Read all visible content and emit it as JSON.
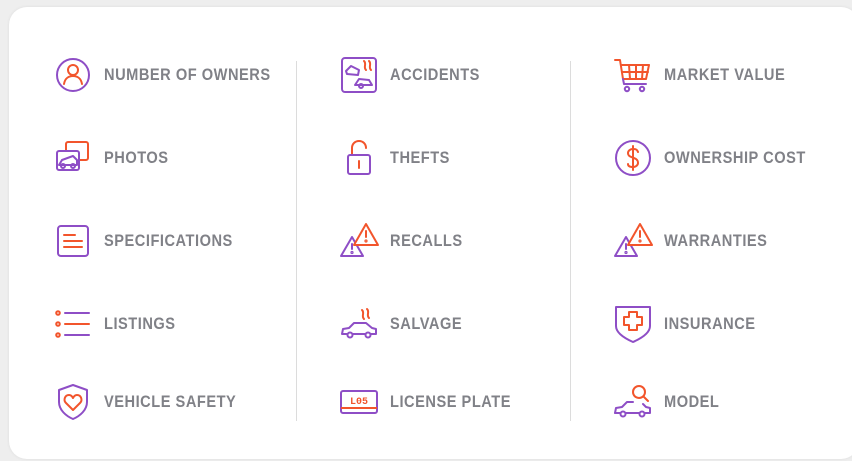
{
  "colors": {
    "purple": "#8e4ec6",
    "orange": "#f2552c",
    "label": "#808187",
    "divider": "#dcdcdc"
  },
  "columns": [
    {
      "items": [
        {
          "label": "NUMBER OF OWNERS",
          "icon": "user-circle-icon"
        },
        {
          "label": "PHOTOS",
          "icon": "car-photo-icon"
        },
        {
          "label": "SPECIFICATIONS",
          "icon": "document-lines-icon"
        },
        {
          "label": "LISTINGS",
          "icon": "list-icon"
        },
        {
          "label": "VEHICLE SAFETY",
          "icon": "shield-heart-icon"
        }
      ]
    },
    {
      "items": [
        {
          "label": "ACCIDENTS",
          "icon": "car-crash-icon"
        },
        {
          "label": "THEFTS",
          "icon": "unlocked-padlock-icon"
        },
        {
          "label": "RECALLS",
          "icon": "warning-triangles-icon"
        },
        {
          "label": "SALVAGE",
          "icon": "car-smoke-icon"
        },
        {
          "label": "LICENSE PLATE",
          "icon": "license-plate-icon",
          "plate_text": "L05"
        }
      ]
    },
    {
      "items": [
        {
          "label": "MARKET VALUE",
          "icon": "shopping-cart-icon"
        },
        {
          "label": "OWNERSHIP COST",
          "icon": "dollar-circle-icon"
        },
        {
          "label": "WARRANTIES",
          "icon": "warning-triangles-icon"
        },
        {
          "label": "INSURANCE",
          "icon": "shield-cross-icon"
        },
        {
          "label": "MODEL",
          "icon": "car-search-icon"
        }
      ]
    }
  ]
}
